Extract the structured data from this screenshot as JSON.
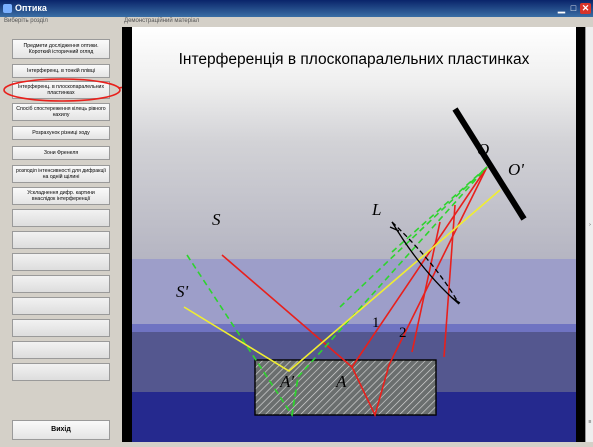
{
  "window": {
    "title": "Оптика",
    "icons": [
      "app-icon",
      "minimize-icon",
      "maximize-icon",
      "close-icon"
    ]
  },
  "left_panel": {
    "caption": "Виберіть розділ",
    "items": [
      "Предмети дослідження оптики. Короткий історичний огляд",
      "Інтерференц. в тонкій плівці",
      "Інтерференц. в плоскопаралельних пластинках",
      "Спосіб спостереження кілець рівного нахилу",
      "Розрахунок різниці ходу",
      "Зони Френеля",
      "розподіл інтенсивності для дифракції на одній щілині",
      "Ускладнення дифр. картини внаслідок інтерференції"
    ],
    "exit_label": "Вихід"
  },
  "demo": {
    "caption": "Демонстраційний матеріал",
    "heading": "Інтерференція в плоскопаралельних пластинках",
    "labels": {
      "O": "O",
      "O_prime": "O'",
      "S": "S",
      "S_prime": "S'",
      "L": "L",
      "A": "A",
      "A_prime": "A'",
      "ray1": "1",
      "ray2": "2"
    }
  },
  "colors": {
    "red_ray": "#e8201c",
    "green_ray": "#2ed42e",
    "yellow_ray": "#f0ee30",
    "annotation": "#e8201c",
    "plate_fill": "#555a5a",
    "title_bar": "#0a246a"
  }
}
